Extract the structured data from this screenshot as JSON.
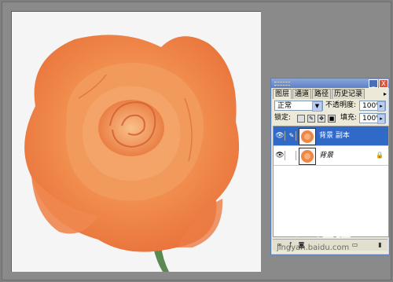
{
  "palette": {
    "tabs": [
      "图层",
      "通道",
      "路径",
      "历史记录"
    ],
    "blend_mode": "正常",
    "opacity_label": "不透明度:",
    "opacity_value": "100%",
    "lock_label": "锁定:",
    "fill_label": "填充:",
    "fill_value": "100%",
    "layers": [
      {
        "name": "背景 副本",
        "selected": true
      },
      {
        "name": "背景",
        "selected": false,
        "locked": true
      }
    ],
    "title_buttons": [
      "_",
      "X"
    ]
  },
  "watermark": {
    "logo": "Bai 经验",
    "url": "jingyan.baidu.com"
  },
  "colors": {
    "rose": "#f08a4b",
    "selection": "#3169c6",
    "panel_bg": "#ece9d8"
  }
}
